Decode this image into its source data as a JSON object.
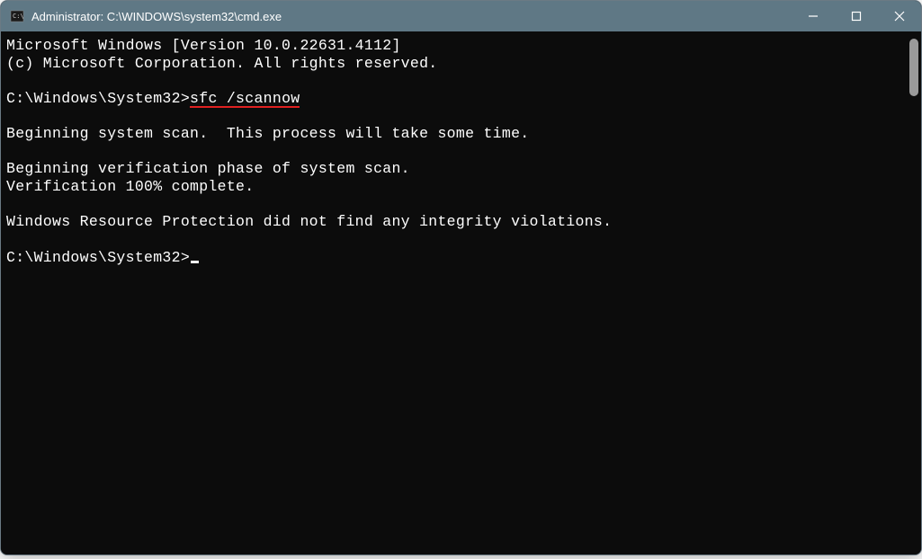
{
  "titlebar": {
    "title": "Administrator: C:\\WINDOWS\\system32\\cmd.exe"
  },
  "terminal": {
    "line1": "Microsoft Windows [Version 10.0.22631.4112]",
    "line2": "(c) Microsoft Corporation. All rights reserved.",
    "prompt1_path": "C:\\Windows\\System32>",
    "prompt1_command": "sfc /scannow",
    "line5": "Beginning system scan.  This process will take some time.",
    "line7": "Beginning verification phase of system scan.",
    "line8": "Verification 100% complete.",
    "line10": "Windows Resource Protection did not find any integrity violations.",
    "prompt2_path": "C:\\Windows\\System32>"
  }
}
